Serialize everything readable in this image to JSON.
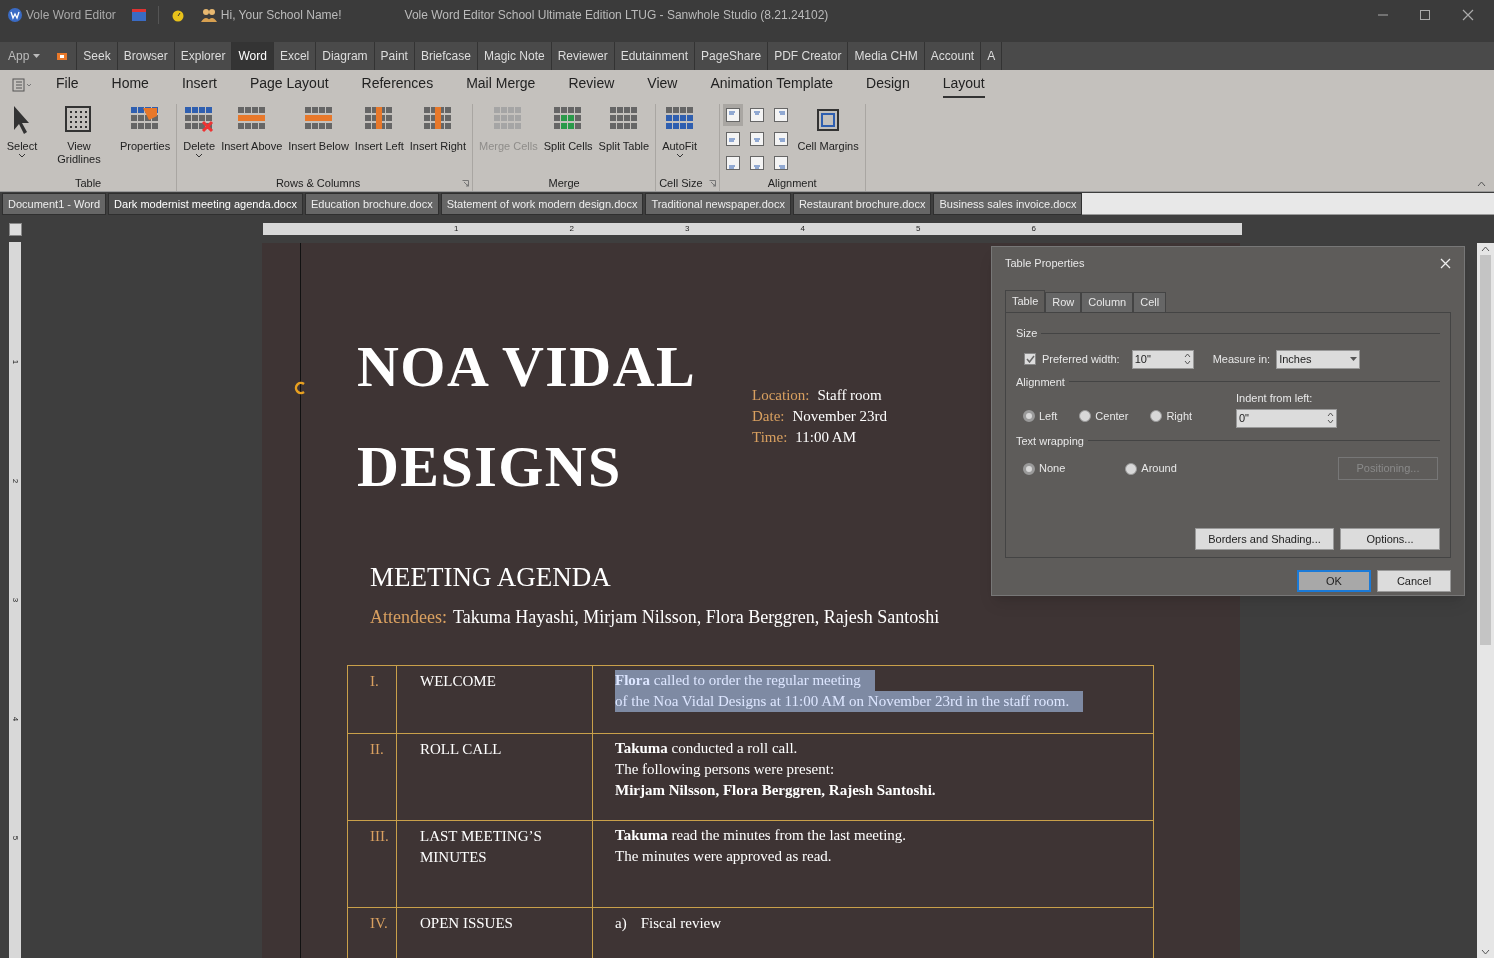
{
  "title_bar": {
    "app_name": "Vole Word Editor",
    "greeting": "Hi, Your School Name!",
    "title": "Vole Word Editor School Ultimate Edition LTUG - Sanwhole Studio (8.21.24102)"
  },
  "app_menu": {
    "label": "App",
    "items": [
      {
        "label": "Seek",
        "selected": false
      },
      {
        "label": "Browser",
        "selected": false
      },
      {
        "label": "Explorer",
        "selected": false
      },
      {
        "label": "Word",
        "selected": true
      },
      {
        "label": "Excel",
        "selected": false
      },
      {
        "label": "Diagram",
        "selected": false
      },
      {
        "label": "Paint",
        "selected": false
      },
      {
        "label": "Briefcase",
        "selected": false
      },
      {
        "label": "Magic Note",
        "selected": false
      },
      {
        "label": "Reviewer",
        "selected": false
      },
      {
        "label": "Edutainment",
        "selected": false
      },
      {
        "label": "PageShare",
        "selected": false
      },
      {
        "label": "PDF Creator",
        "selected": false
      },
      {
        "label": "Media CHM",
        "selected": false
      },
      {
        "label": "Account",
        "selected": false
      },
      {
        "label": "A",
        "selected": false
      }
    ]
  },
  "ribbon_tabs": [
    {
      "label": "File",
      "selected": false
    },
    {
      "label": "Home",
      "selected": false
    },
    {
      "label": "Insert",
      "selected": false
    },
    {
      "label": "Page Layout",
      "selected": false
    },
    {
      "label": "References",
      "selected": false
    },
    {
      "label": "Mail Merge",
      "selected": false
    },
    {
      "label": "Review",
      "selected": false
    },
    {
      "label": "View",
      "selected": false
    },
    {
      "label": "Animation Template",
      "selected": false
    },
    {
      "label": "Design",
      "selected": false
    },
    {
      "label": "Layout",
      "selected": true
    }
  ],
  "ribbon_groups": [
    {
      "label": "Table",
      "launcher": false,
      "buttons": [
        {
          "label": "Select",
          "disabled": false,
          "dropdown": true
        },
        {
          "label": "View Gridlines",
          "disabled": false,
          "dropdown": false
        },
        {
          "label": "Properties",
          "disabled": false,
          "dropdown": false
        }
      ]
    },
    {
      "label": "Rows & Columns",
      "launcher": true,
      "buttons": [
        {
          "label": "Delete",
          "disabled": false,
          "dropdown": true
        },
        {
          "label": "Insert Above",
          "disabled": false,
          "dropdown": false
        },
        {
          "label": "Insert Below",
          "disabled": false,
          "dropdown": false
        },
        {
          "label": "Insert Left",
          "disabled": false,
          "dropdown": false
        },
        {
          "label": "Insert Right",
          "disabled": false,
          "dropdown": false
        }
      ]
    },
    {
      "label": "Merge",
      "launcher": false,
      "buttons": [
        {
          "label": "Merge Cells",
          "disabled": true,
          "dropdown": false
        },
        {
          "label": "Split Cells",
          "disabled": false,
          "dropdown": false
        },
        {
          "label": "Split Table",
          "disabled": false,
          "dropdown": false
        }
      ]
    },
    {
      "label": "Cell Size",
      "launcher": true,
      "buttons": [
        {
          "label": "AutoFit",
          "disabled": false,
          "dropdown": true
        }
      ]
    },
    {
      "label": "Alignment",
      "launcher": false,
      "alignment_buttons": [
        {
          "selected": true
        },
        {
          "selected": false
        },
        {
          "selected": false
        },
        {
          "selected": false
        },
        {
          "selected": false
        },
        {
          "selected": false
        },
        {
          "selected": false
        },
        {
          "selected": false
        },
        {
          "selected": false
        }
      ],
      "buttons": [
        {
          "label": "Cell Margins",
          "disabled": false,
          "dropdown": false
        }
      ]
    }
  ],
  "doc_tabs": [
    {
      "label": "Document1 - Word",
      "selected": false
    },
    {
      "label": "Dark modernist meeting agenda.docx",
      "selected": true
    },
    {
      "label": "Education brochure.docx",
      "selected": false
    },
    {
      "label": "Statement of work modern design.docx",
      "selected": false
    },
    {
      "label": "Traditional newspaper.docx",
      "selected": false
    },
    {
      "label": "Restaurant brochure.docx",
      "selected": false
    },
    {
      "label": "Business sales invoice.docx",
      "selected": false
    }
  ],
  "ruler": {
    "labels": [
      "1",
      "2",
      "3",
      "4",
      "5",
      "6"
    ]
  },
  "vertical_ruler": {
    "labels": [
      "1",
      "2",
      "3",
      "4",
      "5"
    ]
  },
  "document": {
    "title_lines": [
      "NOA VIDAL",
      "DESIGNS"
    ],
    "details": [
      {
        "label": "Location:",
        "value": "Staff room"
      },
      {
        "label": "Date:",
        "value": "November 23rd"
      },
      {
        "label": "Time:",
        "value": "11:00 AM"
      }
    ],
    "heading": "MEETING AGENDA",
    "attendees": {
      "label": "Attendees:",
      "value": "Takuma Hayashi, Mirjam Nilsson, Flora Berggren, Rajesh Santoshi"
    },
    "agenda": [
      {
        "kind": "text",
        "number": "I.",
        "title": "WELCOME",
        "selected": true,
        "lines": [
          "**Flora** called to order the regular meeting",
          "of the Noa Vidal Designs at 11:00 AM on November 23rd in the staff room."
        ]
      },
      {
        "kind": "text",
        "number": "II.",
        "title": "ROLL CALL",
        "selected": false,
        "lines": [
          "**Takuma** conducted a roll call.",
          "The following persons were present:",
          "**Mirjam Nilsson, Flora Berggren, Rajesh Santoshi.**"
        ]
      },
      {
        "kind": "text",
        "number": "III.",
        "title": "LAST MEETING’S MINUTES",
        "selected": false,
        "lines": [
          "**Takuma** read the minutes from the last meeting.",
          "The minutes were approved as read."
        ]
      },
      {
        "kind": "list",
        "number": "IV.",
        "title": "OPEN ISSUES",
        "selected": false,
        "items": [
          {
            "marker": "a)",
            "text": "Fiscal review"
          }
        ]
      }
    ]
  },
  "dialog": {
    "title": "Table Properties",
    "tabs": [
      {
        "label": "Table",
        "selected": true
      },
      {
        "label": "Row",
        "selected": false
      },
      {
        "label": "Column",
        "selected": false
      },
      {
        "label": "Cell",
        "selected": false
      }
    ],
    "size": {
      "label": "Size",
      "preferred_width": {
        "label": "Preferred width:",
        "checked": true,
        "value": "10\""
      },
      "measure": {
        "label": "Measure in:",
        "value": "Inches"
      }
    },
    "alignment": {
      "label": "Alignment",
      "options": [
        {
          "label": "Left",
          "selected": true
        },
        {
          "label": "Center",
          "selected": false
        },
        {
          "label": "Right",
          "selected": false
        }
      ],
      "indent": {
        "label": "Indent from left:",
        "value": "0\""
      }
    },
    "wrapping": {
      "label": "Text wrapping",
      "options": [
        {
          "label": "None",
          "selected": true
        },
        {
          "label": "Around",
          "selected": false
        }
      ],
      "positioning": {
        "label": "Positioning...",
        "disabled": true
      }
    },
    "buttons": [
      {
        "label": "Borders and Shading..."
      },
      {
        "label": "Options..."
      }
    ],
    "ok": {
      "label": "OK"
    },
    "cancel": {
      "label": "Cancel"
    }
  }
}
